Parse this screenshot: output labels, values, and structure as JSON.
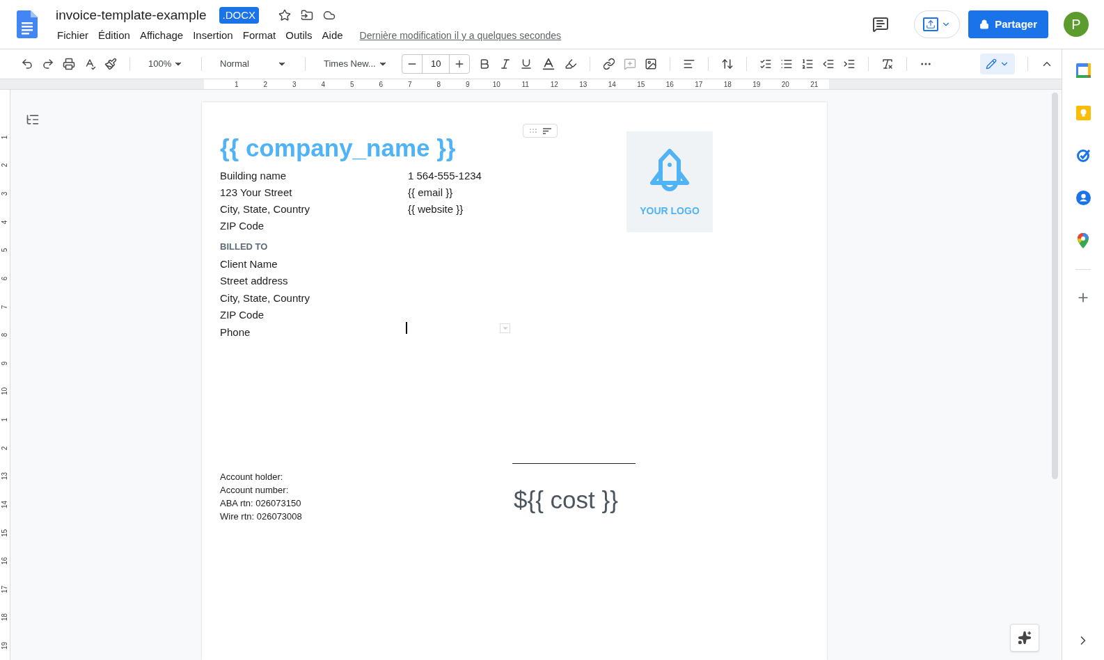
{
  "document": {
    "title": "invoice-template-example",
    "badge": ".DOCX",
    "last_edit": "Dernière modification il y a quelques secondes"
  },
  "menu": [
    "Fichier",
    "Édition",
    "Affichage",
    "Insertion",
    "Format",
    "Outils",
    "Aide"
  ],
  "share_button": "Partager",
  "avatar": "P",
  "toolbar": {
    "zoom": "100%",
    "style": "Normal",
    "font": "Times New...",
    "font_size": "10"
  },
  "ruler": {
    "labels": [
      "1",
      "2",
      "3",
      "4",
      "5",
      "6",
      "7",
      "8",
      "9",
      "10",
      "11",
      "12",
      "13",
      "14",
      "15",
      "16",
      "17",
      "18",
      "19",
      "20",
      "21"
    ]
  },
  "vertical_ruler": {
    "labels": [
      "1",
      "2",
      "3",
      "4",
      "5",
      "6",
      "7",
      "8",
      "9",
      "10",
      "1",
      "2",
      "13",
      "14",
      "15",
      "16",
      "17",
      "18",
      "19"
    ]
  },
  "page": {
    "company": "{{ company_name }}",
    "address": [
      "Building name",
      "123 Your Street",
      "City, State, Country",
      "ZIP Code"
    ],
    "contact": [
      "1 564-555-1234",
      "{{ email }}",
      "{{ website }}"
    ],
    "logo": "YOUR LOGO",
    "billed_to": "BILLED TO",
    "client": [
      "Client Name",
      "Street address",
      "City, State, Country",
      "ZIP Code",
      "Phone"
    ],
    "account": [
      "Account holder:",
      "Account number:",
      "ABA rtn: 026073150",
      "Wire rtn: 026073008"
    ],
    "cost": "${{ cost }}"
  }
}
